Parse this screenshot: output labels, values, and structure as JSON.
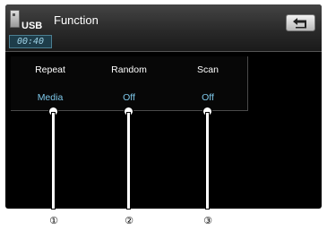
{
  "header": {
    "title": "Function",
    "source": {
      "label": "USB",
      "time": "00:40"
    },
    "back_icon": "return-arrow-icon"
  },
  "functions": [
    {
      "label": "Repeat",
      "value": "Media"
    },
    {
      "label": "Random",
      "value": "Off"
    },
    {
      "label": "Scan",
      "value": "Off"
    }
  ],
  "callouts": [
    "①",
    "②",
    "③"
  ],
  "colors": {
    "value_text": "#7ec8ea",
    "background": "#000000",
    "header": "#2a2a2a"
  }
}
